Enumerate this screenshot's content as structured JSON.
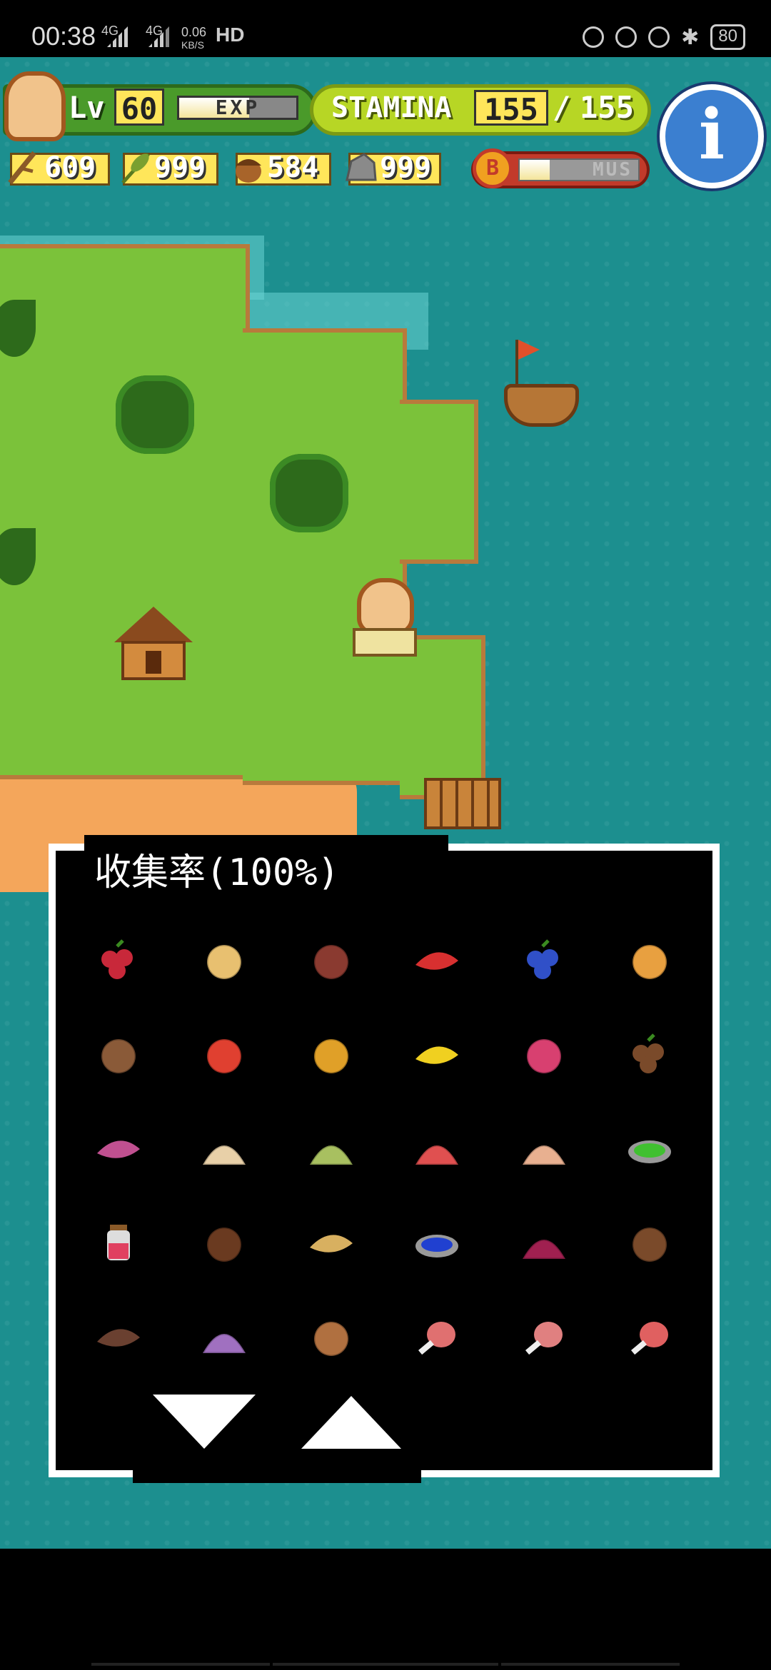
{
  "status_bar": {
    "time": "00:38",
    "network_speed_top": "0.06",
    "network_speed_unit": "KB/S",
    "signal_1": "4G",
    "signal_2": "4G",
    "hd_label": "HD",
    "battery": "80"
  },
  "hud": {
    "level_label": "Lv",
    "level_value": "60",
    "exp_label": "EXP",
    "exp_fill": 0.6,
    "stamina_label": "STAMINA",
    "stamina_current": "155",
    "stamina_separator": "/",
    "stamina_max": "155",
    "info_button": "i",
    "resources": [
      {
        "icon": "branch-icon",
        "value": "609"
      },
      {
        "icon": "leaf-icon",
        "value": "999"
      },
      {
        "icon": "acorn-icon",
        "value": "584"
      },
      {
        "icon": "stone-icon",
        "value": "999"
      }
    ],
    "bonus": {
      "coin_label": "B",
      "gauge_text": "MUS",
      "gauge_fill": 0.25
    }
  },
  "collection": {
    "title": "收集率(100%)",
    "items": [
      {
        "icon": "raspberry-icon",
        "color": "#c8283a"
      },
      {
        "icon": "potato-icon",
        "color": "#e8c070"
      },
      {
        "icon": "nut-icon",
        "color": "#8a3a30"
      },
      {
        "icon": "mushroom-icon",
        "color": "#d83030"
      },
      {
        "icon": "blueberry-icon",
        "color": "#3050c8"
      },
      {
        "icon": "onion-icon",
        "color": "#e8a040"
      },
      {
        "icon": "walnut-icon",
        "color": "#8a5a38"
      },
      {
        "icon": "tomato-icon",
        "color": "#e04030"
      },
      {
        "icon": "pineapple-icon",
        "color": "#e0a028"
      },
      {
        "icon": "banana-icon",
        "color": "#f0d020"
      },
      {
        "icon": "dragonfruit-icon",
        "color": "#d84070"
      },
      {
        "icon": "coffee-bean-icon",
        "color": "#7a4a2a"
      },
      {
        "icon": "sweet-potato-icon",
        "color": "#c05090"
      },
      {
        "icon": "flour-pile-icon",
        "color": "#e8d0a8"
      },
      {
        "icon": "green-powder-icon",
        "color": "#a8c060"
      },
      {
        "icon": "red-powder-icon",
        "color": "#e05050"
      },
      {
        "icon": "spice-pile-icon",
        "color": "#e8b090"
      },
      {
        "icon": "green-sauce-dish-icon",
        "color": "#40c030"
      },
      {
        "icon": "jam-jar-icon",
        "color": "#e04060"
      },
      {
        "icon": "coconut-half-icon",
        "color": "#6a3a20"
      },
      {
        "icon": "cocoa-pod-icon",
        "color": "#d8b060"
      },
      {
        "icon": "blue-sauce-dish-icon",
        "color": "#2040d0"
      },
      {
        "icon": "berry-pile-icon",
        "color": "#a02050"
      },
      {
        "icon": "coconut-icon",
        "color": "#7a4a2a"
      },
      {
        "icon": "chocolate-bar-icon",
        "color": "#6a4030"
      },
      {
        "icon": "purple-powder-icon",
        "color": "#a070c0"
      },
      {
        "icon": "seed-icon",
        "color": "#b07040"
      },
      {
        "icon": "meat-bone-icon",
        "color": "#e07070"
      },
      {
        "icon": "drumstick-icon",
        "color": "#e08080"
      },
      {
        "icon": "ham-icon",
        "color": "#e06060"
      }
    ],
    "scroll_down": "scroll-down-arrow",
    "scroll_up": "scroll-up-arrow"
  }
}
